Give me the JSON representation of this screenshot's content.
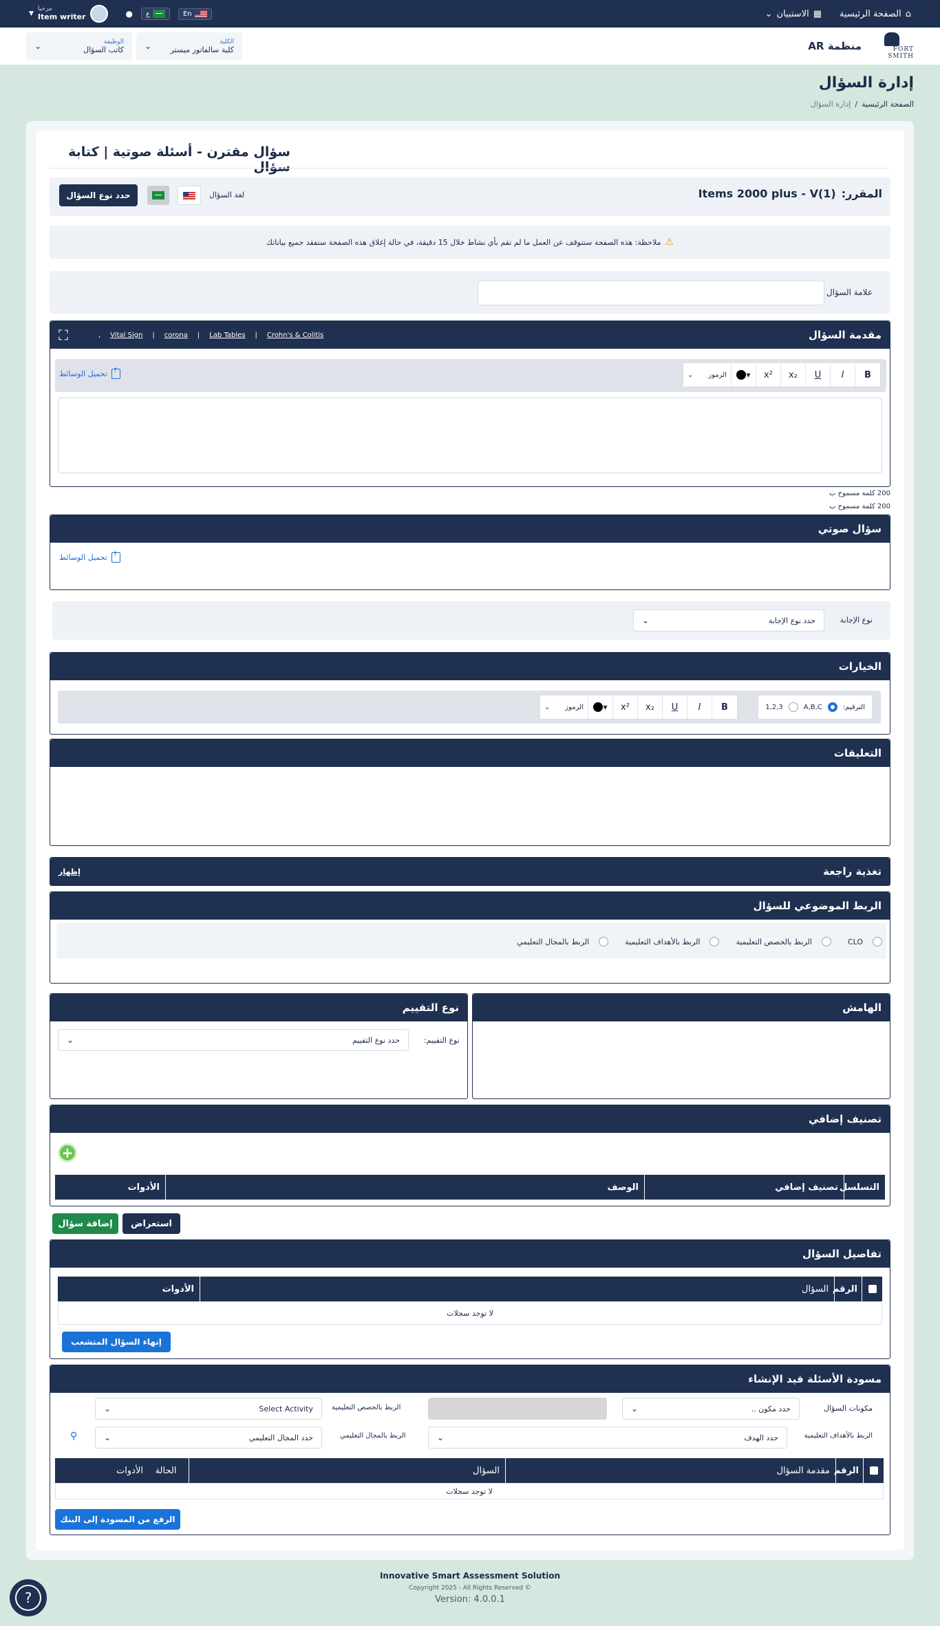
{
  "topbar": {
    "home": "الصفحة الرئيسية",
    "dashboard": "الاستبيان",
    "greeting": "مرحبا",
    "username": "Item writer",
    "lang_en": "En",
    "lang_ar": "ع"
  },
  "header": {
    "org": "منظمة AR",
    "logo_text": "FORT SMITH",
    "college_label": "الكلية",
    "college_value": "كلية سالفاتور ميستر",
    "role_label": "الوظيفة",
    "role_value": "كاتب السؤال"
  },
  "page": {
    "title": "إدارة السؤال",
    "breadcrumb_home": "الصفحة الرئيسية",
    "breadcrumb_sep": "/",
    "breadcrumb_current": "إدارة السؤال"
  },
  "question": {
    "title": "سؤال مقترن - أسئلة صوتية | كتابة سؤال",
    "course_label": "المقرر:",
    "course_value": "Items 2000 plus - V(1)",
    "lang_label": "لغة السؤال",
    "set_type_btn": "حدد نوع السؤال",
    "notice": "ملاحظة: هذه الصفحة ستتوقف عن العمل ما لم تقم بأي نشاط خلال 15 دقيقة، في حالة إغلاق هذه الصفحة ستفقد جميع بياناتك",
    "mark_label": "علامة السؤال"
  },
  "intro": {
    "title": "مقدمة السؤال",
    "links": [
      "Vital Sign",
      "corona",
      "Lab Tables",
      "Crohn's & Colitis"
    ],
    "upload": "تحميل الوسائط",
    "symbols": "الرموز",
    "limit1": "200 كلمة مسموح ب",
    "limit2": "200 كلمة مسموح ب"
  },
  "audio": {
    "title": "سؤال صوتي",
    "upload": "تحميل الوسائط"
  },
  "answer": {
    "label": "نوع الإجابة",
    "placeholder": "حدد نوع الإجابة"
  },
  "choices": {
    "title": "الخيارات",
    "numbering_label": "الترقيم:",
    "opt_abc": "A,B,C",
    "opt_123": "1,2,3",
    "symbols": "الرموز"
  },
  "comments": {
    "title": "التعليقات"
  },
  "feedback": {
    "title": "تغذية راجعة",
    "show": "إظهار"
  },
  "mapping": {
    "title": "الربط الموضوعي للسؤال",
    "opts": [
      "CLO",
      "الربط بالحصص التعليمية",
      "الربط بالأهداف التعليمية",
      "الربط بالمجال التعليمي"
    ]
  },
  "margin": {
    "title": "الهامش"
  },
  "assessment": {
    "title": "نوع التقييم",
    "label": "نوع التقييم:",
    "placeholder": "حدد نوع التقييم"
  },
  "extra": {
    "title": "تصنيف إضافي",
    "cols": [
      "التسلسل",
      "تصنيف إضافي",
      "الوصف",
      "الأدوات"
    ]
  },
  "actions": {
    "review": "استعراض",
    "add": "إضافة سؤال"
  },
  "details": {
    "title": "تفاصيل السؤال",
    "cols": [
      "الرقم",
      "السؤال",
      "الأدوات"
    ],
    "empty": "لا توجد سجلات",
    "finish": "إنهاء السؤال المتشعب"
  },
  "drafts": {
    "title": "مسودة الأسئلة قيد الإنشاء",
    "components_label": "مكونات السؤال",
    "components_ph": "حدد مكون ..",
    "lessons_label": "الربط بالحصص التعليمية",
    "activity_ph": "Select Activity",
    "objectives_label": "الربط بالأهداف التعليمية",
    "objectives_ph": "حدد الهدف",
    "domain_label": "الربط بالمجال التعليمي",
    "domain_ph": "حدد المجال التعليمي",
    "cols": [
      "الرقم",
      "مقدمة السؤال",
      "السؤال",
      "الحالة",
      "الأدوات"
    ],
    "empty": "لا توجد سجلات",
    "upload_btn": "الرفع من المسودة إلى البنك"
  },
  "footer": {
    "title": "Innovative Smart Assessment Solution",
    "copyright": "Copyright 2025 - All Rights Reserved ©",
    "version": "Version: 4.0.0.1"
  }
}
